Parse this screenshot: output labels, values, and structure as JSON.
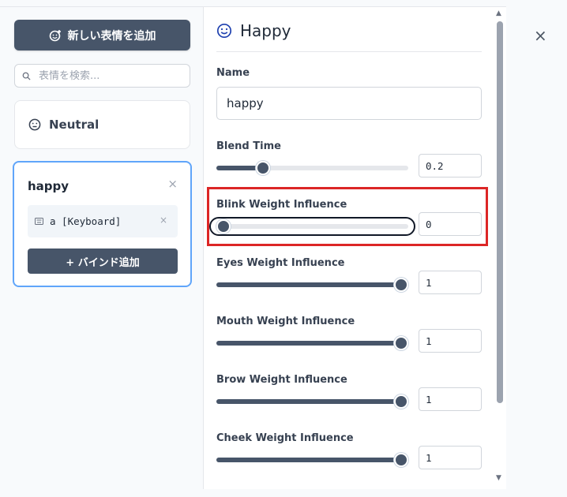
{
  "sidebar": {
    "add_button_label": "新しい表情を追加",
    "search_placeholder": "表情を検索...",
    "expressions": [
      {
        "name": "Neutral"
      },
      {
        "name": "happy",
        "bindings": [
          {
            "text": "a [Keyboard]"
          }
        ],
        "bind_button_label": "+ バインド追加"
      }
    ]
  },
  "main": {
    "title": "Happy",
    "name_label": "Name",
    "name_value": "happy",
    "params": [
      {
        "label": "Blend Time",
        "value": "0.2",
        "fraction": 0.22
      },
      {
        "label": "Blink Weight Influence",
        "value": "0",
        "fraction": 0.0
      },
      {
        "label": "Eyes Weight Influence",
        "value": "1",
        "fraction": 1.0
      },
      {
        "label": "Mouth Weight Influence",
        "value": "1",
        "fraction": 1.0
      },
      {
        "label": "Brow Weight Influence",
        "value": "1",
        "fraction": 1.0
      },
      {
        "label": "Cheek Weight Influence",
        "value": "1",
        "fraction": 1.0
      }
    ]
  },
  "colors": {
    "accent": "#475569",
    "highlight": "#dc2626",
    "selected_border": "#60a5fa"
  },
  "icons": [
    "add-emoji-icon",
    "search-icon",
    "neutral-face-icon",
    "keyboard-icon",
    "smile-icon",
    "close-icon"
  ]
}
